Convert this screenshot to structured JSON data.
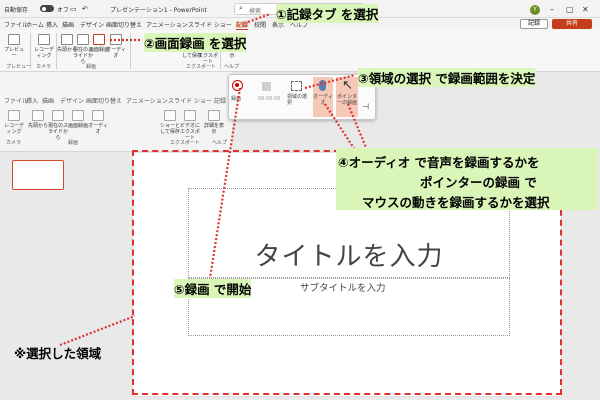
{
  "app": {
    "autosave_label": "自動保存",
    "autosave_state": "オフ",
    "filename": "プレゼンテーション1 - PowerPoint",
    "search_placeholder": "検索",
    "user_initial": "Y"
  },
  "menu": {
    "items": [
      "ファイル",
      "ホーム",
      "挿入",
      "描画",
      "デザイン",
      "画面切り替え",
      "アニメーション",
      "スライド ショー",
      "記録",
      "校閲",
      "表示",
      "ヘルプ"
    ],
    "active": "記録",
    "record_button": "記録",
    "share_button": "共有"
  },
  "ribbon": {
    "buttons": [
      {
        "label": "プレビュー"
      },
      {
        "label": "レコーディング"
      },
      {
        "label": "先頭から"
      },
      {
        "label": "現在のスライドから"
      },
      {
        "label": "画面録画"
      },
      {
        "label": "オーディオ"
      },
      {
        "label": "ショーとして保存"
      },
      {
        "label": "ビデオにエクスポート"
      },
      {
        "label": "詳細を表示"
      }
    ],
    "groups": [
      "プレビュー",
      "カメラ",
      "録画",
      "エクスポート",
      "ヘルプ"
    ]
  },
  "back_menu": {
    "items": [
      "ファイル",
      "挿入",
      "描画",
      "デザイン",
      "画面切り替え",
      "アニメーション",
      "スライド ショー",
      "記録"
    ]
  },
  "back_ribbon": {
    "labels": [
      "レコーディング",
      "先頭から",
      "現在のスライドから",
      "画面録画",
      "オーディオ",
      "ショーとして保存",
      "ビデオにエクスポート",
      "詳細を表示"
    ],
    "groups": [
      "カメラ",
      "録画",
      "エクスポート",
      "ヘルプ"
    ]
  },
  "recording_toolbar": {
    "record_label": "録画",
    "timer": "00:00:00",
    "select_area_label": "領域の選択",
    "audio_label": "オーディオ",
    "pointer_label": "ポインターの録画"
  },
  "slide": {
    "title_placeholder": "タイトルを入力",
    "subtitle_placeholder": "サブタイトルを入力"
  },
  "annotations": {
    "a1": "①記録タブ を選択",
    "a2": "②画面録画 を選択",
    "a3": "③領域の選択 で録画範囲を決定",
    "a4_line1": "④オーディオ で音声を録画するかを",
    "a4_line2": "ポインターの録画 で",
    "a4_line3": "マウスの動きを録画するかを選択",
    "a5": "⑤録画 で開始",
    "selected_area": "※選択した領域"
  },
  "colors": {
    "annotation_highlight": "#d9f5b8",
    "annotation_line": "#e03030",
    "accent": "#c43e1c"
  }
}
